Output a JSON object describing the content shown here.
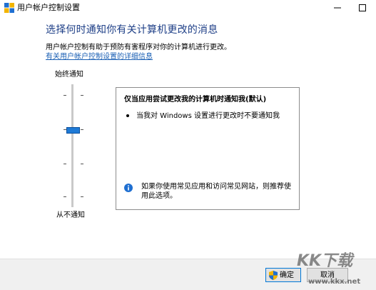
{
  "window": {
    "title": "用户帐户控制设置",
    "controls": {
      "minimize_icon": "minimize-icon",
      "maximize_icon": "maximize-icon"
    }
  },
  "header": {
    "heading": "选择何时通知你有关计算机更改的消息",
    "description": "用户帐户控制有助于预防有害程序对你的计算机进行更改。",
    "link": "有关用户帐户控制设置的详细信息"
  },
  "slider": {
    "top_label": "始终通知",
    "bottom_label": "从不通知",
    "levels": 4,
    "selected_level": 3,
    "accent": "#1f7ad6"
  },
  "panel": {
    "title": "仅当应用尝试更改我的计算机时通知我(默认)",
    "bullets": [
      "当我对 Windows 设置进行更改时不要通知我"
    ],
    "info_icon": "info-icon",
    "info_text": "如果你使用常见应用和访问常见网站，则推荐使用此选项。"
  },
  "footer": {
    "ok_label": "确定",
    "ok_icon": "shield-icon",
    "cancel_label": "取消"
  },
  "watermark": {
    "title": "KK下载",
    "url": "www.kkx.net"
  },
  "colors": {
    "heading": "#1e3f87",
    "link": "#1a5fb4",
    "ok_border": "#0078d7"
  }
}
